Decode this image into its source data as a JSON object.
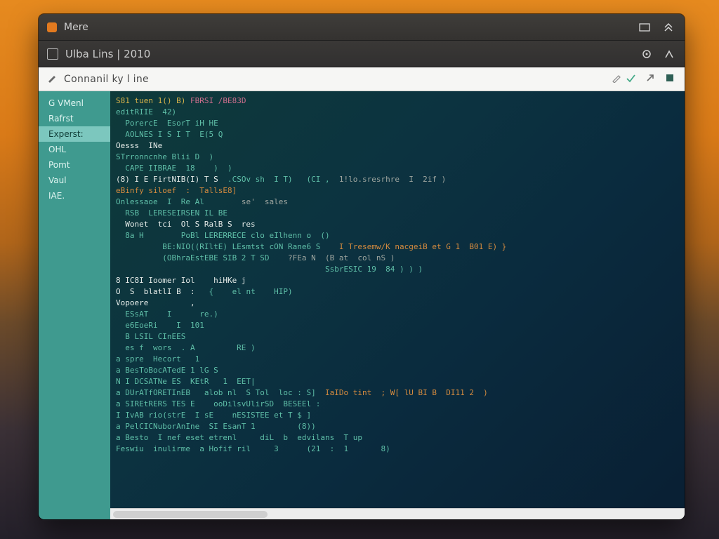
{
  "colors": {
    "accent_orange": "#e27a1f",
    "sidebar_bg": "#3f9a8f",
    "sidebar_sel": "#7cc7be",
    "editor_bg_from": "#0e3a3a",
    "editor_bg_to": "#091f33"
  },
  "titlebar": {
    "title": "Mere",
    "min_icon": "window-minimize-icon",
    "max_icon": "window-maximize-icon"
  },
  "subheader": {
    "title": "Ulba  Lins | 2010",
    "refresh_icon": "refresh-icon",
    "share_icon": "share-icon"
  },
  "command": {
    "prompt_icon": "pencil-icon",
    "value": "Connanil ky l ine",
    "edit_icon": "pencil-icon",
    "ok_icon": "check-icon",
    "go_icon": "arrow-up-right-icon",
    "box_icon": "square-icon"
  },
  "sidebar": {
    "items": [
      {
        "label": "G VMenl"
      },
      {
        "label": "Rafrst"
      },
      {
        "label": "Experst:"
      },
      {
        "label": "OHL"
      },
      {
        "label": "Pomt"
      },
      {
        "label": "Vaul"
      },
      {
        "label": "IAE."
      }
    ],
    "selected_index": 2
  },
  "code": {
    "lines": [
      [
        [
          "c-y",
          "S81 tuen 1() B)"
        ],
        [
          "c-p",
          " FBRSI /BE83D"
        ]
      ],
      [
        [
          "c-t",
          "editRIIE  42)"
        ]
      ],
      [
        [
          "c-t",
          "  PorercE  EsorT iH HE"
        ]
      ],
      [
        [
          "c-t",
          "  AOLNES I S I T  E(5 Q"
        ]
      ],
      [
        [
          "c-w",
          "Oesss  INe"
        ]
      ],
      [
        [
          "c-t",
          "STrronncnhe Blii D  )"
        ]
      ],
      [
        [
          "c-t",
          "  CAPE IIBRAE  18    )  )"
        ]
      ],
      [
        [
          "c-w",
          "(8) I E FirtNIB(I) T S"
        ],
        [
          "c-t",
          "  .CSOv sh  I T)   (CI ,"
        ],
        [
          "c-d",
          "  1!lo.sresrhre  I  2if )"
        ]
      ],
      [
        [
          "c-o",
          "eBinfy siloef  :  TallsE8]"
        ]
      ],
      [
        [
          "c-t",
          "Onlessaoe  I  Re Al"
        ],
        [
          "c-d",
          "        se'  sales"
        ]
      ],
      [
        [
          "c-t",
          "  RSB  LERESEIRSEN IL BE"
        ]
      ],
      [
        [
          "c-w",
          "  Wonet  tci  Ol S RalB S  res"
        ]
      ],
      [
        [
          "c-t",
          "  8a H        PoBl LERERRECE clo eIlhenn o  ()"
        ]
      ],
      [
        [
          "c-t",
          "          BE:NIO((RIltE) LEsmtst cON Rane6 S"
        ],
        [
          "c-o",
          "    I Tresemw/K nacgeiB et G 1  B01 E) }"
        ]
      ],
      [
        [
          "c-t",
          "          (OBhraEstEBE SIB 2 T SD"
        ],
        [
          "c-d",
          "    ?FEa N  (B at  col nS )"
        ]
      ],
      [
        [
          "c-t",
          "                                             SsbrESIC 19  84 ) ) )"
        ]
      ],
      [
        [
          "c-w",
          "8 IC8I Ioomer Iol    hiHKe j"
        ]
      ],
      [
        [
          "c-w",
          "O  S  blatlI B  :"
        ],
        [
          "c-t",
          "   {    el nt    HIP)"
        ]
      ],
      [
        [
          "c-w",
          "Vopoere         ,"
        ]
      ],
      [
        [
          "c-t",
          "  ESsAT    I      re.)"
        ]
      ],
      [
        [
          "c-t",
          "  e6EoeRi    I  101"
        ]
      ],
      [
        [
          "c-t",
          "  B LSIL CInEES"
        ]
      ],
      [
        [
          "c-t",
          "  es f  wors  . A         RE )"
        ]
      ],
      [
        [
          "c-t",
          "a spre  Hecort   1"
        ]
      ],
      [
        [
          "c-t",
          "a BesToBocATedE 1 lG S"
        ]
      ],
      [
        [
          "c-t",
          "N I DCSATNe ES  KEtR   1  EET|"
        ]
      ],
      [
        [
          "c-t",
          "a DUrATfORETInEB   alob nl  S Tol  loc : S]  "
        ],
        [
          "c-o",
          "IaIDo tint  ; W[ lU BI B  DI11 2  )"
        ]
      ],
      [
        [
          "c-t",
          "a SIREtRERS TES E    ooDilsvUlirSD  BESEEl :"
        ]
      ],
      [
        [
          "c-t",
          "I IvAB rio(strE  I sE    nESISTEE et T $ ]"
        ]
      ],
      [
        [
          "c-t",
          "a PelCICNuborAnIne  SI EsanT 1         (8))"
        ]
      ],
      [
        [
          "c-t",
          "a Besto  I nef eset etrenl     diL  b  edvilans  T up"
        ]
      ],
      [
        [
          "c-t",
          "Feswiu  inulirme  a Hofif ril     3      (21  :  1       8)"
        ]
      ]
    ]
  }
}
